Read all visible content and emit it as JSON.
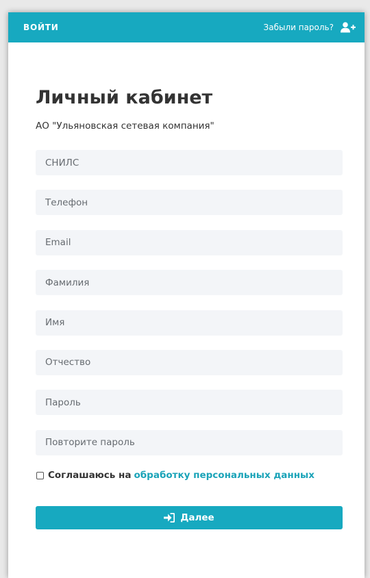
{
  "header": {
    "login_tab": "ВОЙТИ",
    "forgot_password": "Забыли пароль?",
    "register_icon": "user-plus-icon"
  },
  "main": {
    "title": "Личный кабинет",
    "org": "АО \"Ульяновская сетевая компания\""
  },
  "form": {
    "snils_placeholder": "СНИЛС",
    "phone_placeholder": "Телефон",
    "email_placeholder": "Email",
    "lastname_placeholder": "Фамилия",
    "firstname_placeholder": "Имя",
    "middlename_placeholder": "Отчество",
    "password_placeholder": "Пароль",
    "password_repeat_placeholder": "Повторите пароль",
    "consent_text": "Соглашаюсь на",
    "consent_link": "обработку персональных данных",
    "consent_checked": false,
    "submit_label": "Далее",
    "submit_icon": "sign-in-icon"
  },
  "colors": {
    "accent": "#17a9c0",
    "link": "#1aa3b8",
    "field_bg": "#f3f5f8",
    "text": "#333333"
  }
}
